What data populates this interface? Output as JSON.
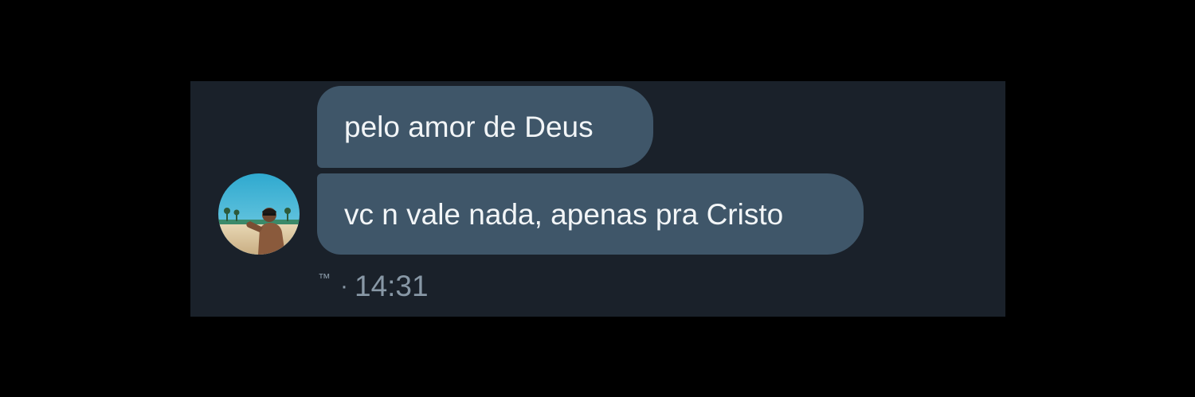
{
  "conversation": {
    "messages": [
      {
        "text": "pelo amor de Deus"
      },
      {
        "text": "vc n vale nada, apenas pra Cristo"
      }
    ],
    "meta": {
      "status_glyph": "™",
      "separator": "·",
      "time": "14:31"
    },
    "avatar": {
      "description_icon": "user-avatar-icon"
    }
  },
  "colors": {
    "page_background": "#000000",
    "panel_background": "#1a212a",
    "bubble_background": "#3f5669",
    "bubble_text": "#f2f5f7",
    "meta_text": "#8898a6"
  }
}
